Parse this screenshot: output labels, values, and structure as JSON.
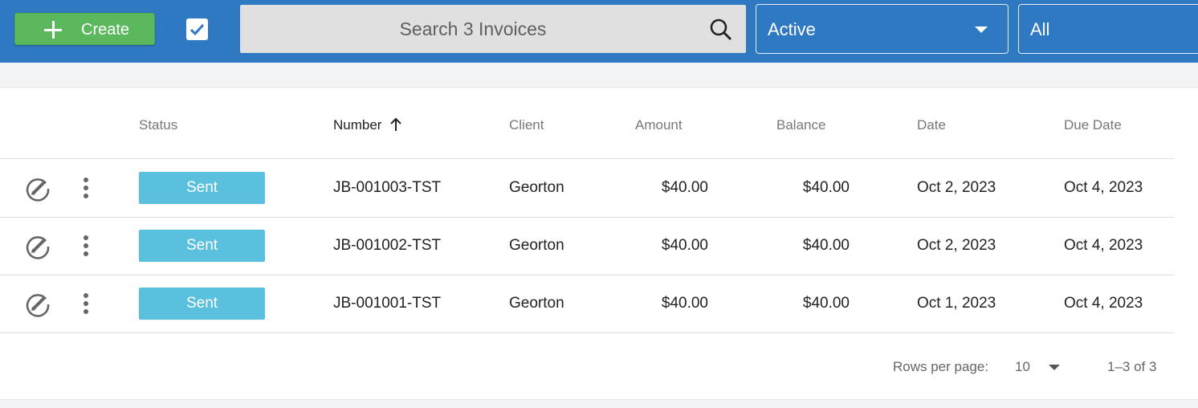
{
  "toolbar": {
    "create_label": "Create",
    "search_placeholder": "Search 3 Invoices",
    "status_filter": "Active",
    "second_filter": "All",
    "color_bar": "#2f78c2",
    "color_create": "#5cb85c"
  },
  "table": {
    "columns": [
      "Status",
      "Number",
      "Client",
      "Amount",
      "Balance",
      "Date",
      "Due Date"
    ],
    "sorted_column": "Number",
    "sort_direction": "ascending",
    "rows": [
      {
        "status": "Sent",
        "number": "JB-001003-TST",
        "client": "Georton",
        "amount": "$40.00",
        "balance": "$40.00",
        "date": "Oct 2, 2023",
        "due_date": "Oct 4, 2023"
      },
      {
        "status": "Sent",
        "number": "JB-001002-TST",
        "client": "Georton",
        "amount": "$40.00",
        "balance": "$40.00",
        "date": "Oct 2, 2023",
        "due_date": "Oct 4, 2023"
      },
      {
        "status": "Sent",
        "number": "JB-001001-TST",
        "client": "Georton",
        "amount": "$40.00",
        "balance": "$40.00",
        "date": "Oct 1, 2023",
        "due_date": "Oct 4, 2023"
      }
    ],
    "status_color": "#5bc0de"
  },
  "pagination": {
    "rows_per_page_label": "Rows per page:",
    "rows_per_page": "10",
    "range": "1–3 of 3"
  },
  "icons": [
    "plus-icon",
    "checkbox-checked-icon",
    "search-icon",
    "chevron-down-icon",
    "edit-icon",
    "more-vert-icon",
    "arrow-up-icon"
  ]
}
